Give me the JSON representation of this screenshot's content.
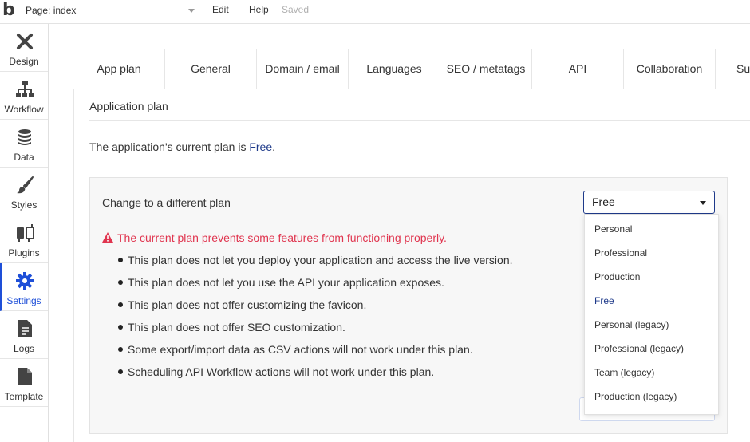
{
  "topbar": {
    "logo": "b",
    "page_select": "Page: index",
    "menu_edit": "Edit",
    "menu_help": "Help",
    "status": "Saved"
  },
  "leftnav": {
    "items": [
      {
        "label": "Design",
        "icon": "design-icon"
      },
      {
        "label": "Workflow",
        "icon": "workflow-icon"
      },
      {
        "label": "Data",
        "icon": "database-icon"
      },
      {
        "label": "Styles",
        "icon": "brush-icon"
      },
      {
        "label": "Plugins",
        "icon": "plug-icon"
      },
      {
        "label": "Settings",
        "icon": "gear-icon",
        "active": true
      },
      {
        "label": "Logs",
        "icon": "document-icon"
      },
      {
        "label": "Template",
        "icon": "template-icon"
      }
    ]
  },
  "tabs": [
    "App plan",
    "General",
    "Domain / email",
    "Languages",
    "SEO / metatags",
    "API",
    "Collaboration",
    "Su"
  ],
  "main": {
    "section_title": "Application plan",
    "current_plan_prefix": "The application's current plan is ",
    "current_plan_value": "Free",
    "current_plan_suffix": ".",
    "change_label": "Change to a different plan",
    "warning": "The current plan prevents some features from functioning properly.",
    "bullets": [
      "This plan does not let you deploy your application and access the live version.",
      "This plan does not let you use the API your application exposes.",
      "This plan does not offer customizing the favicon.",
      "This plan does not offer SEO customization.",
      "Some export/import data as CSV actions will not work under this plan.",
      "Scheduling API Workflow actions will not work under this plan."
    ],
    "plan_select_value": "Free",
    "plan_options": [
      "Personal",
      "Professional",
      "Production",
      "Free",
      "Personal (legacy)",
      "Professional (legacy)",
      "Team (legacy)",
      "Production (legacy)"
    ]
  },
  "colors": {
    "accent": "#1e4fd8",
    "warning": "#e0354f",
    "link": "#1e3a8a"
  }
}
